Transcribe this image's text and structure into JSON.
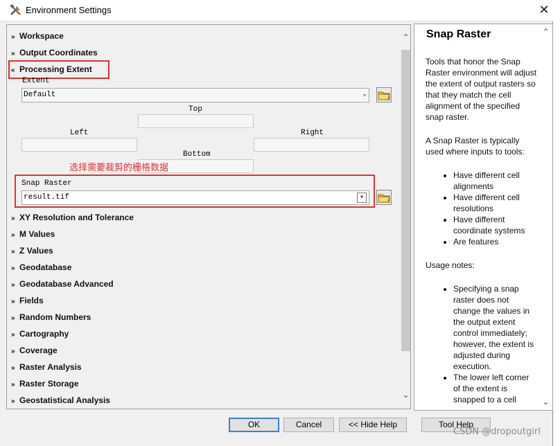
{
  "window": {
    "title": "Environment Settings",
    "close_glyph": "✕"
  },
  "sections_top": [
    {
      "label": "Workspace",
      "chev": "»"
    },
    {
      "label": "Output Coordinates",
      "chev": "»"
    },
    {
      "label": "Processing Extent",
      "chev": "«"
    }
  ],
  "extent": {
    "label": "Extent",
    "value": "Default",
    "top_label": "Top",
    "left_label": "Left",
    "right_label": "Right",
    "bottom_label": "Bottom"
  },
  "annotation": "选择需要裁剪的栅格数据",
  "snap": {
    "label": "Snap Raster",
    "value": "result.tif"
  },
  "sections_bottom": [
    "XY Resolution and Tolerance",
    "M Values",
    "Z Values",
    "Geodatabase",
    "Geodatabase Advanced",
    "Fields",
    "Random Numbers",
    "Cartography",
    "Coverage",
    "Raster Analysis",
    "Raster Storage",
    "Geostatistical Analysis"
  ],
  "help": {
    "title": "Snap Raster",
    "p1": "Tools that honor the Snap Raster environment will adjust the extent of output rasters so that they match the cell alignment of the specified snap raster.",
    "p2": "A Snap Raster is typically used where inputs to tools:",
    "bullets1": [
      "Have different cell alignments",
      "Have different cell resolutions",
      "Have different coordinate systems",
      "Are features"
    ],
    "p3": "Usage notes:",
    "bullets2": [
      "Specifying a snap raster does not change the values in the output extent control immediately; however, the extent is adjusted during execution.",
      "The lower left corner of the extent is snapped to a cell"
    ]
  },
  "buttons": {
    "ok": "OK",
    "cancel": "Cancel",
    "hide_help": "<< Hide Help",
    "tool_help": "Tool Help"
  },
  "watermark": "CSDN @dropoutgirl",
  "colors": {
    "highlight": "#e03030",
    "annotation": "#e53030",
    "default_button_border": "#3c7fd8"
  }
}
